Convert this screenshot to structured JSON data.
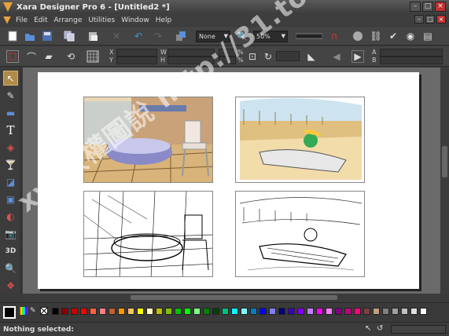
{
  "window": {
    "title": "Xara Designer Pro 6 - [Untitled2 *]",
    "controls": {
      "minimize": "–",
      "maximize": "□",
      "close": "×"
    }
  },
  "menu": {
    "items": [
      "File",
      "Edit",
      "Arrange",
      "Utilities",
      "Window",
      "Help"
    ]
  },
  "toolbar": {
    "quality_value": "None",
    "zoom_value": "50%"
  },
  "infobar": {
    "x_label": "X",
    "y_label": "Y",
    "w_label": "W",
    "h_label": "H",
    "percent1": "%",
    "percent2": "%",
    "a_label": "A",
    "b_label": "B"
  },
  "status": {
    "text": "Nothing selected:"
  },
  "watermark": {
    "text": "xyz版權圖說 http://31.to"
  },
  "palette": {
    "colors": [
      "#000000",
      "#8b0000",
      "#c00000",
      "#ff0000",
      "#ff6040",
      "#ff8080",
      "#c06030",
      "#ff9900",
      "#ffc060",
      "#ffff00",
      "#ffffc0",
      "#c0c000",
      "#80c000",
      "#00c000",
      "#00ff00",
      "#80ff80",
      "#008000",
      "#004000",
      "#00c080",
      "#00ffff",
      "#80ffff",
      "#0080c0",
      "#0000ff",
      "#8080ff",
      "#000080",
      "#4000c0",
      "#8000ff",
      "#c080ff",
      "#ff00ff",
      "#ff80ff",
      "#800080",
      "#c00080",
      "#ff0080",
      "#804040",
      "#c0a080",
      "#808080",
      "#a0a0a0",
      "#c0c0c0",
      "#e0e0e0",
      "#ffffff"
    ]
  }
}
